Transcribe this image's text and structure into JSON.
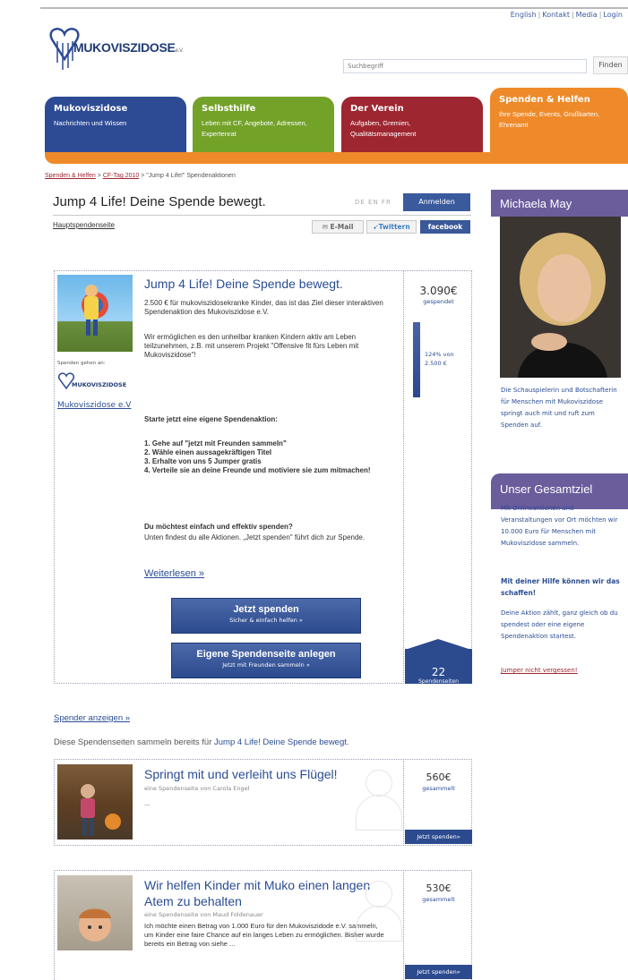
{
  "header": {
    "toplinks": [
      "English",
      "Kontakt",
      "Media",
      "Login"
    ],
    "logo_text": "MUKOVISZIDOSE",
    "logo_suffix": "e.V.",
    "search_placeholder": "Suchbegriff",
    "search_button": "Finden"
  },
  "nav": [
    {
      "title": "Mukoviszidose",
      "sub": "Nachrichten und Wissen",
      "color": "#2d4b95"
    },
    {
      "title": "Selbsthilfe",
      "sub": "Leben mit CF, Angebote, Adressen, Expertenrat",
      "color": "#73a229"
    },
    {
      "title": "Der Verein",
      "sub": "Aufgaben, Gremien, Qualitätsmanagement",
      "color": "#9e2630"
    },
    {
      "title": "Spenden & Helfen",
      "sub": "Ihre Spende, Events, Grußkarten, Ehrenamt",
      "color": "#ee8a2a"
    }
  ],
  "breadcrumb": {
    "items": [
      "Spenden & Helfen",
      "CF-Tag 2010",
      "\"Jump 4 Life!\" Spendenaktionen"
    ],
    "sep": ">"
  },
  "page": {
    "title": "Jump 4 Life! Deine Spende bewegt.",
    "languages": "DE EN FR",
    "login_button": "Anmelden",
    "main_page_link": "Hauptspendenseite",
    "share_email": "E-Mail",
    "share_twitter": "Twittern",
    "share_facebook": "facebook"
  },
  "campaign": {
    "title": "Jump 4 Life! Deine Spende bewegt.",
    "donates_to": "Spenden gehen an:",
    "mini_logo": "MUKOVISZIDOSE",
    "org_link": "Mukoviszidose e.V",
    "intro1": "2.500 € für mukoviszidosekranke Kinder, das ist das Ziel dieser interaktiven Spendenaktion des Mukoviszidose e.V.",
    "intro2": "Wir ermöglichen es den unheilbar kranken Kindern aktiv am Leben teilzunehmen, z.B. mit unserem Projekt \"Offensive fit fürs Leben mit Mukoviszidose\"!",
    "start_heading": "Starte jetzt eine eigene Spendenaktion:",
    "steps": [
      "1. Gehe auf \"jetzt mit Freunden sammeln\"",
      "2. Wähle einen aussagekräftigen Titel",
      "3. Erhalte von uns 5 Jumper gratis",
      "4. Verteile sie an deine Freunde und motiviere sie zum mitmachen!"
    ],
    "effective_heading": "Du möchtest einfach und effektiv spenden?",
    "effective_text": "Unten findest du alle Aktionen. „Jetzt spenden\" führt dich zur Spende.",
    "read_more": "Weiterlesen »",
    "donate_button": {
      "main": "Jetzt spenden",
      "sub": "Sicher & einfach helfen »"
    },
    "create_button": {
      "main": "Eigene Spendenseite anlegen",
      "sub": "Jetzt mit Freunden sammeln »"
    },
    "amount": "3.090€",
    "amount_label": "gespendet",
    "progress_fraction": 1.0,
    "progress_label": "124% von 2.500 €",
    "pages_count": "22",
    "pages_label": "Spendenseiten"
  },
  "sidebar": {
    "person_name": "Michaela May",
    "person_text": "Die Schauspielerin und Botschafterin für Menschen mit Mukoviszidose springt auch mit und ruft zum Spenden auf.",
    "goal_title": "Unser Gesamtziel",
    "goal_text1": "Mit Onlineaktionen und Veranstaltungen vor Ort möchten wir 10.000 Euro für Menschen mit Mukoviszidose sammeln.",
    "goal_text2": "Mit deiner Hilfe können wir das schaffen!",
    "goal_text3": "Deine Aktion zählt, ganz gleich ob du spendest oder eine eigene Spendenaktion startest.",
    "goal_link": "Jumper nicht vergessen!"
  },
  "lower": {
    "show_donors": "Spender anzeigen »",
    "intro_prefix": "Diese Spendenseiten sammeln bereits für ",
    "intro_highlight": "Jump 4 Life! Deine Spende bewegt.",
    "cards": [
      {
        "title": "Springt mit und verleiht uns Flügel!",
        "sub": "eine Spendenseite von Carola Engel",
        "desc": "...",
        "amount": "560€",
        "amount_label": "gesammelt",
        "button": "Jetzt spenden»"
      },
      {
        "title": "Wir helfen Kinder mit Muko einen langen Atem zu behalten",
        "sub": "eine Spendenseite von Maud Foldenauer",
        "desc": "Ich möchte einen Betrag von 1.000 Euro für den Mukoviszidode e.V. sammeln, um Kinder eine faire Chance auf ein langes Leben zu ermöglichen. Bisher wurde bereits ein Betrag von siehe ...",
        "amount": "530€",
        "amount_label": "gesammelt",
        "button": "Jetzt spenden»"
      }
    ]
  }
}
